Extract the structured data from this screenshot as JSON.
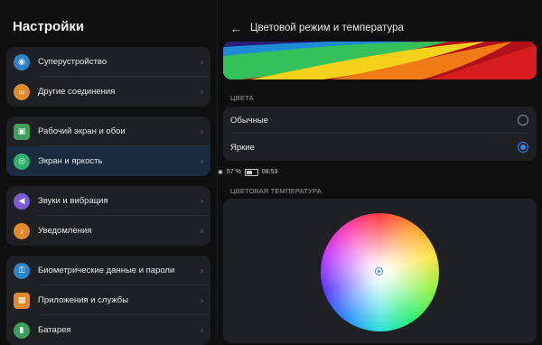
{
  "status": {
    "battery": "57 %",
    "time": "08:53",
    "battery_level": 0.57
  },
  "left": {
    "title": "Настройки",
    "groups": [
      {
        "items": [
          {
            "label": "Суперустройство",
            "icon": "super-device-icon",
            "color": "#2d84c7"
          },
          {
            "label": "Другие соединения",
            "icon": "link-icon",
            "color": "#e08a2e"
          }
        ]
      },
      {
        "items": [
          {
            "label": "Рабочий экран и обои",
            "icon": "wallpaper-icon",
            "color": "#3f9e5a"
          },
          {
            "label": "Экран и яркость",
            "icon": "eye-icon",
            "color": "#2fb06f"
          }
        ]
      },
      {
        "items": [
          {
            "label": "Звуки и вибрация",
            "icon": "speaker-icon",
            "color": "#7b5cd6"
          },
          {
            "label": "Уведомления",
            "icon": "bell-icon",
            "color": "#e08a2e"
          }
        ]
      },
      {
        "items": [
          {
            "label": "Биометрические данные и пароли",
            "icon": "key-icon",
            "color": "#2d84c7"
          },
          {
            "label": "Приложения и службы",
            "icon": "apps-icon",
            "color": "#e08a2e"
          },
          {
            "label": "Батарея",
            "icon": "battery-icon",
            "color": "#3f9e5a"
          }
        ]
      }
    ]
  },
  "right": {
    "title": "Цветовой режим и температура",
    "colors_header": "ЦВЕТА",
    "options": [
      {
        "label": "Обычные",
        "selected": false
      },
      {
        "label": "Яркие",
        "selected": true
      }
    ],
    "temp_header": "ЦВЕТОВАЯ ТЕМПЕРАТУРА"
  },
  "accent": "#3a7ff1"
}
